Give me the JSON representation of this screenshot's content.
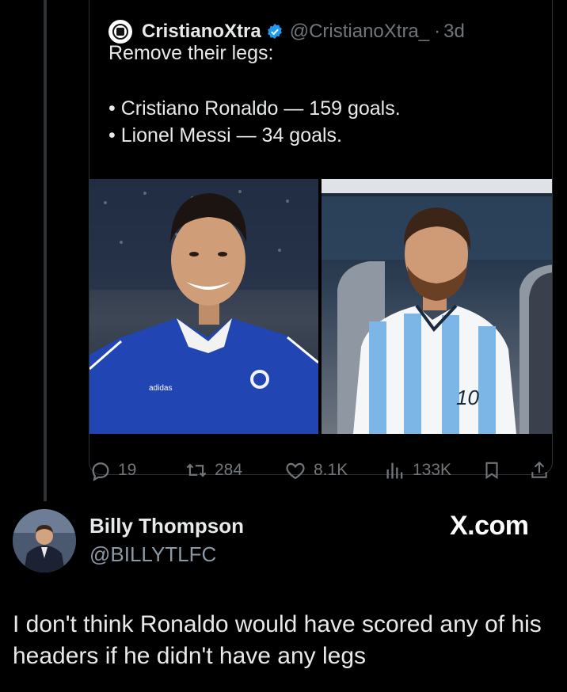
{
  "quoted_tweet": {
    "display_name": "CristianoXtra",
    "handle": "@CristianoXtra_",
    "separator": "·",
    "time": "3d",
    "text_line1": "Remove their legs:",
    "text_line2": "• Cristiano Ronaldo — 159 goals.",
    "text_line3": "• Lionel Messi — 34 goals.",
    "verified_color": "#1d9bf0",
    "actions": {
      "replies": "19",
      "reposts": "284",
      "likes": "8.1K",
      "views": "133K"
    }
  },
  "reply": {
    "display_name": "Billy Thompson",
    "handle": "@BILLYTLFC",
    "watermark": "X.com",
    "text": "I don't think Ronaldo would have scored any of his headers if he didn't have any legs"
  },
  "icons": [
    "verified-badge-icon",
    "reply-icon",
    "repost-icon",
    "like-icon",
    "views-icon",
    "bookmark-icon",
    "share-icon"
  ]
}
